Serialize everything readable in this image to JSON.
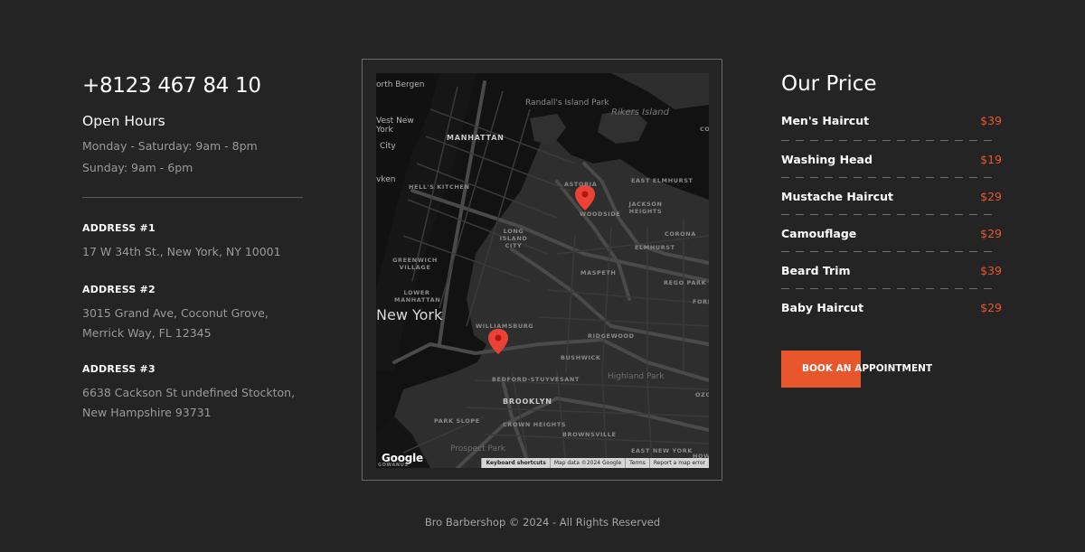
{
  "contact": {
    "phone": "+8123 467 84 10",
    "hours_title": "Open Hours",
    "hours": [
      "Monday - Saturday: 9am - 8pm",
      "Sunday: 9am - 6pm"
    ]
  },
  "addresses": [
    {
      "title": "ADDRESS #1",
      "lines": [
        "17 W 34th St., New York, NY 10001"
      ]
    },
    {
      "title": "ADDRESS #2",
      "lines": [
        "3015 Grand Ave, Coconut Grove,",
        "Merrick Way, FL 12345"
      ]
    },
    {
      "title": "ADDRESS #3",
      "lines": [
        "6638 Cackson St undefined Stockton,",
        "New Hampshire 93731"
      ]
    }
  ],
  "map": {
    "labels": {
      "north_bergen": "orth Bergen",
      "west_new_york": "Vest New York",
      "city": "City",
      "weehawken": "vken",
      "manhattan": "MANHATTAN",
      "hells_kitchen": "HELL'S KITCHEN",
      "randalls": "Randall's Island Park",
      "rikers": "Rikers Island",
      "astoria": "ASTORIA",
      "east_elmhurst": "EAST ELMHURST",
      "jackson_heights": "JACKSON HEIGHTS",
      "woodside": "WOODSIDE",
      "long_island_city": "LONG ISLAND CITY",
      "elmhurst": "ELMHURST",
      "corona": "CORONA",
      "greenwich": "GREENWICH VILLAGE",
      "lower_manhattan": "LOWER MANHATTAN",
      "maspeth": "MASPETH",
      "rego_park": "REGO PARK",
      "new_york": "New York",
      "williamsburg": "WILLIAMSBURG",
      "ridgewood": "RIDGEWOOD",
      "bushwick": "BUSHWICK",
      "bed_stuy": "BEDFORD-STUYVESANT",
      "highland_park": "Highland Park",
      "brooklyn": "BROOKLYN",
      "park_slope": "PARK SLOPE",
      "crown_heights": "CROWN HEIGHTS",
      "brownsville": "BROWNSVILLE",
      "prospect_park": "Prospect Park",
      "east_new_york": "EAST NEW YORK",
      "co": "CO",
      "ozo": "OZO",
      "fore": "FORE",
      "how": "HOW",
      "gowanus": "GOWANUS"
    },
    "google_logo": "Google",
    "attribution": [
      "Keyboard shortcuts",
      "Map data ©2024 Google",
      "Terms",
      "Report a map error"
    ],
    "pin_color": "#ea4335"
  },
  "prices": {
    "title": "Our Price",
    "items": [
      {
        "name": "Men's Haircut",
        "price": "$39"
      },
      {
        "name": "Washing Head",
        "price": "$19"
      },
      {
        "name": "Mustache Haircut",
        "price": "$29"
      },
      {
        "name": "Camouflage",
        "price": "$29"
      },
      {
        "name": "Beard Trim",
        "price": "$39"
      },
      {
        "name": "Baby Haircut",
        "price": "$29"
      }
    ],
    "button_label": "BOOK AN APPOINTMENT"
  },
  "footer": "Bro Barbershop © 2024 - All Rights Reserved",
  "colors": {
    "background": "#242424",
    "accent": "#e8572c",
    "muted_text": "#9a9a9a"
  }
}
